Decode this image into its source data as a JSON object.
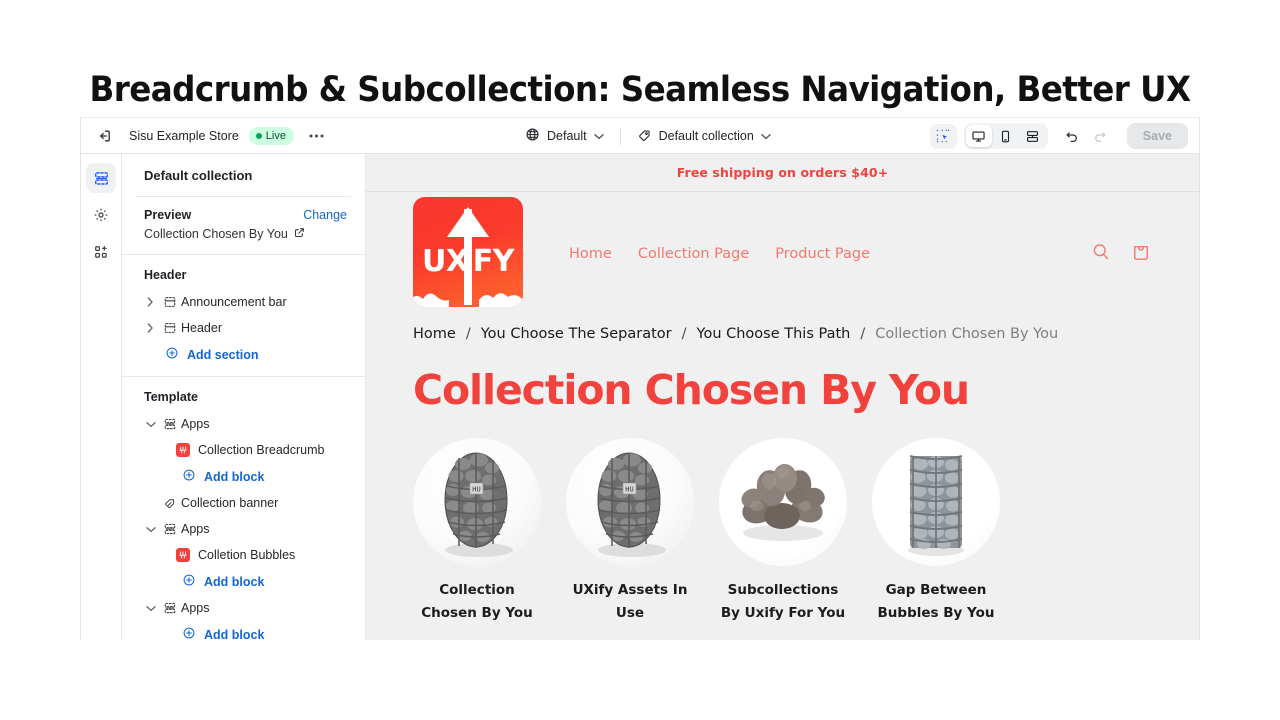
{
  "page": {
    "headline": "Breadcrumb & Subcollection: Seamless Navigation, Better UX"
  },
  "topbar": {
    "exit_icon": "exit-icon",
    "store_name": "Sisu Example Store",
    "status_badge": "Live",
    "more_label": "•••",
    "theme_selector": {
      "icon": "globe-icon",
      "label": "Default",
      "chevron": "chevron-down-icon"
    },
    "template_selector": {
      "icon": "tag-icon",
      "label": "Default collection",
      "chevron": "chevron-down-icon"
    },
    "tools": {
      "inspect": "inspector-icon",
      "desktop": "desktop-icon",
      "mobile": "mobile-icon",
      "fullwidth": "fullwidth-icon",
      "undo": "undo-icon",
      "redo": "redo-icon",
      "save_label": "Save"
    }
  },
  "rail": {
    "items": [
      {
        "name": "sections-icon",
        "label": "Sections",
        "active": true
      },
      {
        "name": "settings-icon",
        "label": "Settings",
        "active": false
      },
      {
        "name": "apps-icon",
        "label": "Apps",
        "active": false
      }
    ]
  },
  "sidebar": {
    "title": "Default collection",
    "preview": {
      "label": "Preview",
      "change_label": "Change",
      "value": "Collection Chosen By You",
      "external_icon": "external-link-icon"
    },
    "header_group": {
      "heading": "Header",
      "rows": [
        {
          "label": "Announcement bar",
          "icon": "section-icon",
          "caret": "chevron-right-icon"
        },
        {
          "label": "Header",
          "icon": "section-icon",
          "caret": "chevron-right-icon"
        }
      ],
      "add_label": "Add section"
    },
    "template_group": {
      "heading": "Template",
      "apps1": {
        "label": "Apps",
        "caret": "chevron-down-icon"
      },
      "block1": {
        "label": "Collection Breadcrumb",
        "icon": "app-block-icon"
      },
      "add1": "Add block",
      "banner": {
        "label": "Collection banner",
        "icon": "banner-icon"
      },
      "apps2": {
        "label": "Apps",
        "caret": "chevron-down-icon"
      },
      "block2": {
        "label": "Colletion Bubbles",
        "icon": "app-block-icon"
      },
      "add2": "Add block",
      "apps3": {
        "label": "Apps",
        "caret": "chevron-down-icon"
      },
      "add3": "Add block"
    }
  },
  "preview": {
    "announcement": "Free shipping on orders $40+",
    "logo": {
      "left_text": "UX",
      "right_text": "FY"
    },
    "nav": [
      "Home",
      "Collection Page",
      "Product Page"
    ],
    "icons": {
      "search": "search-icon",
      "cart": "shopping-bag-icon"
    },
    "breadcrumb": {
      "separator": "/",
      "items": [
        "Home",
        "You Choose The Separator",
        "You Choose This Path",
        "Collection Chosen By You"
      ]
    },
    "collection_title": "Collection Chosen By You",
    "bubbles": [
      {
        "label": "Collection Chosen By You",
        "image": "gabion-basket-stone"
      },
      {
        "label": "UXify Assets In Use",
        "image": "gabion-basket-stone"
      },
      {
        "label": "Subcollections By Uxify For You",
        "image": "stone-pile"
      },
      {
        "label": "Gap Between Bubbles By You",
        "image": "gabion-column-stone"
      }
    ]
  },
  "colors": {
    "brand_red": "#f2423d",
    "link_blue": "#1565d8",
    "live_green": "#0c5132",
    "nav_coral": "#f07a6d"
  }
}
